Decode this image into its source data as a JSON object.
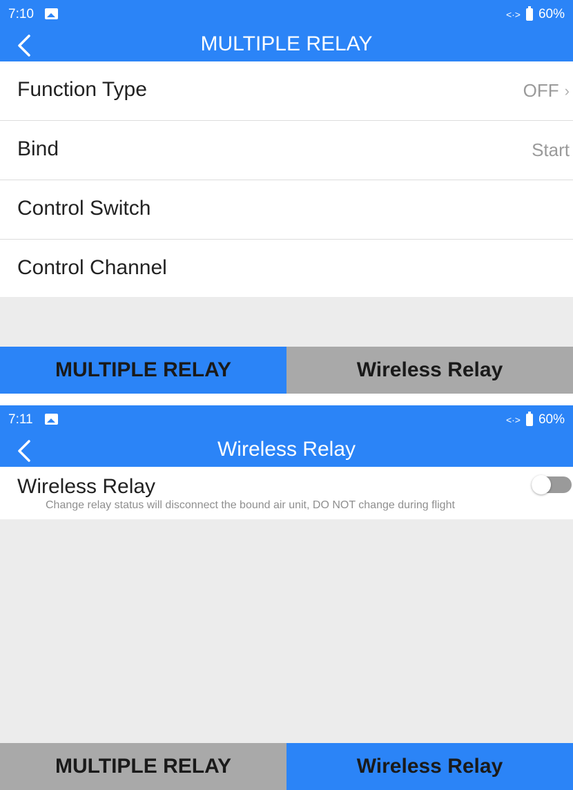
{
  "screen1": {
    "status": {
      "time": "7:10",
      "link_icon": "<·>",
      "battery": "60%"
    },
    "title": "MULTIPLE RELAY",
    "rows": [
      {
        "label": "Function Type",
        "value": "OFF",
        "chevron": "›"
      },
      {
        "label": "Bind",
        "value": "Start"
      },
      {
        "label": "Control Switch"
      },
      {
        "label": "Control Channel"
      }
    ],
    "tabs": [
      {
        "label": "MULTIPLE RELAY",
        "active": true
      },
      {
        "label": "Wireless Relay",
        "active": false
      }
    ]
  },
  "screen2": {
    "status": {
      "time": "7:11",
      "link_icon": "<·>",
      "battery": "60%"
    },
    "title": "Wireless Relay",
    "setting": {
      "label": "Wireless Relay",
      "note": "Change relay status will disconnect the bound air unit, DO NOT change during flight",
      "toggle_on": false
    },
    "tabs": [
      {
        "label": "MULTIPLE RELAY",
        "active": false
      },
      {
        "label": "Wireless Relay",
        "active": true
      }
    ]
  },
  "colors": {
    "accent": "#2b84f7",
    "tab_inactive": "#a9a9a9",
    "background": "#ececec"
  },
  "icons": [
    "back-arrow-icon",
    "image-icon",
    "link-icon",
    "battery-icon",
    "chevron-right-icon",
    "toggle-switch"
  ]
}
